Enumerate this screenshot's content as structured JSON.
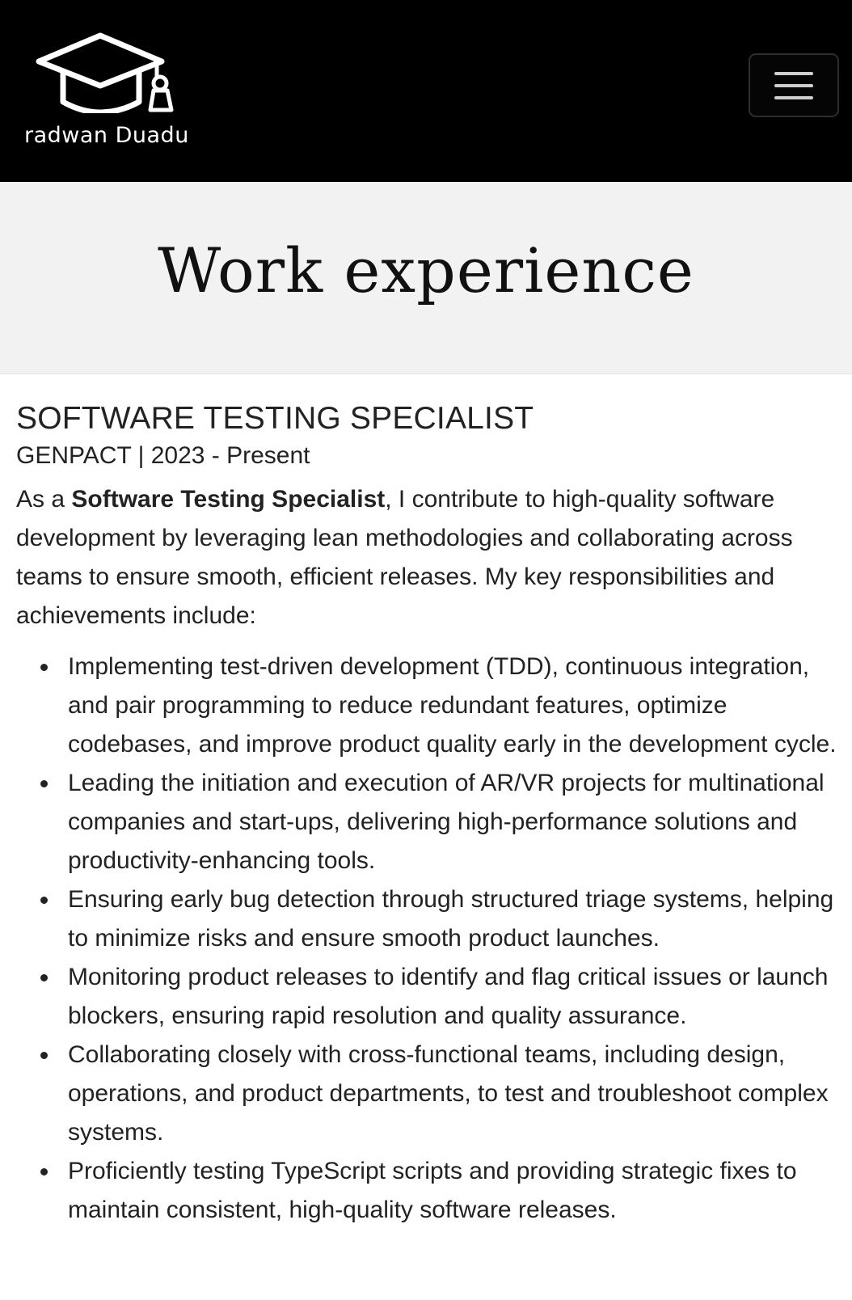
{
  "brand": {
    "name": "radwan Duadu",
    "logo_icon": "graduation-cap-icon"
  },
  "nav": {
    "menu_icon": "hamburger-menu-icon"
  },
  "hero": {
    "title": "Work experience"
  },
  "job": {
    "title": "SOFTWARE TESTING SPECIALIST",
    "meta": "GENPACT | 2023 - Present",
    "intro_prefix": "As a ",
    "intro_bold": "Software Testing Specialist",
    "intro_suffix": ", I contribute to high-quality software development by leveraging lean methodologies and collaborating across teams to ensure smooth, efficient releases. My key responsibilities and achievements include:",
    "duties": [
      "Implementing test-driven development (TDD), continuous integration, and pair programming to reduce redundant features, optimize codebases, and improve product quality early in the development cycle.",
      "Leading the initiation and execution of AR/VR projects for multinational companies and start-ups, delivering high-performance solutions and productivity-enhancing tools.",
      "Ensuring early bug detection through structured triage systems, helping to minimize risks and ensure smooth product launches.",
      "Monitoring product releases to identify and flag critical issues or launch blockers, ensuring rapid resolution and quality assurance.",
      "Collaborating closely with cross-functional teams, including design, operations, and product departments, to test and troubleshoot complex systems.",
      "Proficiently testing TypeScript scripts and providing strategic fixes to maintain consistent, high-quality software releases."
    ]
  },
  "colors": {
    "navbar_bg": "#000000",
    "hero_bg": "#f2f2f2",
    "text": "#222222"
  }
}
